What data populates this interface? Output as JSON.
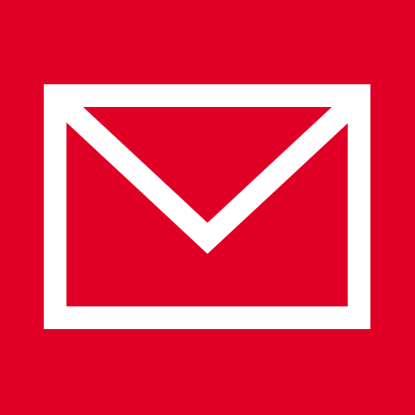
{
  "app_tile": {
    "icon": "mail-envelope-icon",
    "colors": {
      "background": "#E10025",
      "glyph": "#FFFFFF"
    }
  }
}
